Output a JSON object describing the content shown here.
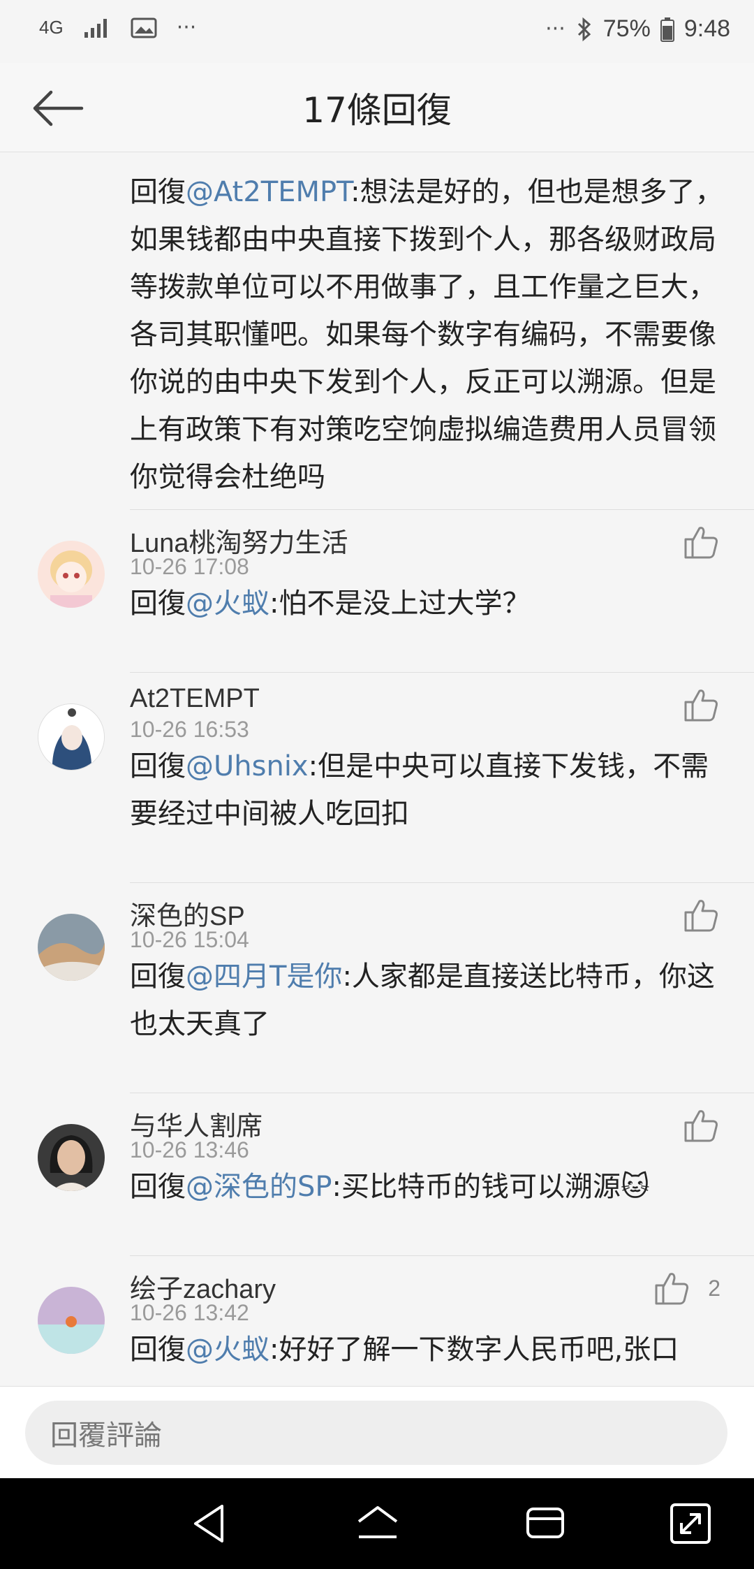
{
  "status_bar": {
    "network": "4G",
    "battery": "75%",
    "time": "9:48",
    "icons": [
      "signal-icon",
      "image-icon",
      "more-icon",
      "bluetooth-icon",
      "battery-icon"
    ]
  },
  "header": {
    "title": "17條回復"
  },
  "top_reply": {
    "prefix": "回復",
    "mention": "@At2TEMPT",
    "text": ":想法是好的，但也是想多了，如果钱都由中央直接下拨到个人，那各级财政局等拨款单位可以不用做事了，且工作量之巨大，各司其职懂吧。如果每个数字有编码，不需要像你说的由中央下发到个人，反正可以溯源。但是上有政策下有对策吃空饷虚拟编造费用人员冒领你觉得会杜绝吗"
  },
  "comments": [
    {
      "user": "Luna桃淘努力生活",
      "time": "10-26 17:08",
      "prefix": "回復",
      "mention": "@火蚁",
      "text": ":怕不是没上过大学？",
      "likes": ""
    },
    {
      "user": "At2TEMPT",
      "time": "10-26 16:53",
      "prefix": "回復",
      "mention": "@Uhsnix",
      "text": ":但是中央可以直接下发钱，不需要经过中间被人吃回扣",
      "likes": ""
    },
    {
      "user": "深色的SP",
      "time": "10-26 15:04",
      "prefix": "回復",
      "mention": "@四月T是你",
      "text": ":人家都是直接送比特币，你这也太天真了",
      "likes": ""
    },
    {
      "user": "与华人割席",
      "time": "10-26 13:46",
      "prefix": "回復",
      "mention": "@深色的SP",
      "text": ":买比特币的钱可以溯源",
      "emoji": "🐱",
      "likes": ""
    },
    {
      "user": "绘子zachary",
      "time": "10-26 13:42",
      "prefix": "回復",
      "mention": "@火蚁",
      "text": ":好好了解一下数字人民币吧,张口",
      "likes": "2"
    }
  ],
  "input": {
    "placeholder": "回覆評論"
  },
  "colors": {
    "mention": "#4f7dad",
    "background": "#f5f5f5"
  },
  "nav_icons": [
    "back-triangle-icon",
    "home-icon",
    "recents-icon",
    "expand-icon"
  ]
}
